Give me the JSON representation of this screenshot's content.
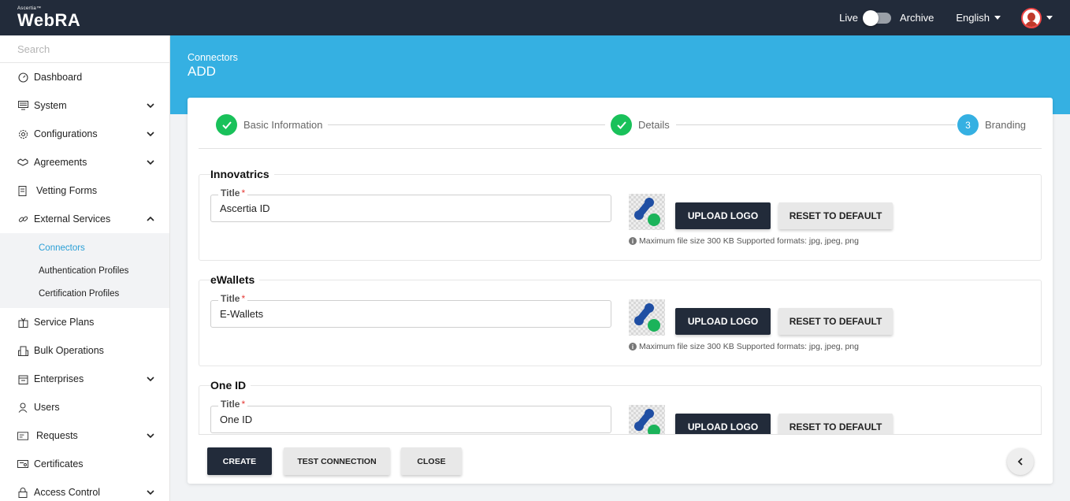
{
  "header": {
    "brand_small": "Ascertia™",
    "brand_main": "WebRA",
    "live_label": "Live",
    "archive_label": "Archive",
    "language": "English"
  },
  "search": {
    "placeholder": "Search"
  },
  "sidebar": {
    "items": [
      {
        "label": "Dashboard",
        "icon": "dashboard-icon",
        "expandable": false
      },
      {
        "label": "System",
        "icon": "system-icon",
        "expandable": true
      },
      {
        "label": "Configurations",
        "icon": "gear-icon",
        "expandable": true
      },
      {
        "label": "Agreements",
        "icon": "handshake-icon",
        "expandable": true
      },
      {
        "label": "Vetting Forms",
        "icon": "form-icon",
        "expandable": false
      },
      {
        "label": "External Services",
        "icon": "link-icon",
        "expandable": true,
        "expanded": true
      },
      {
        "label": "Service Plans",
        "icon": "gift-icon",
        "expandable": false
      },
      {
        "label": "Bulk Operations",
        "icon": "building-icon",
        "expandable": false
      },
      {
        "label": "Enterprises",
        "icon": "enterprise-icon",
        "expandable": true
      },
      {
        "label": "Users",
        "icon": "user-icon",
        "expandable": false
      },
      {
        "label": "Requests",
        "icon": "requests-icon",
        "expandable": true
      },
      {
        "label": "Certificates",
        "icon": "certificate-icon",
        "expandable": false
      },
      {
        "label": "Access Control",
        "icon": "lock-icon",
        "expandable": true
      }
    ],
    "sub_items": [
      {
        "label": "Connectors",
        "active": true
      },
      {
        "label": "Authentication Profiles",
        "active": false
      },
      {
        "label": "Certification Profiles",
        "active": false
      }
    ]
  },
  "page": {
    "breadcrumb": "Connectors",
    "title": "ADD"
  },
  "stepper": {
    "steps": [
      {
        "label": "Basic Information",
        "state": "done"
      },
      {
        "label": "Details",
        "state": "done"
      },
      {
        "number": "3",
        "label": "Branding",
        "state": "current"
      }
    ]
  },
  "sections": [
    {
      "title": "Innovatrics",
      "field_label": "Title",
      "field_value": "Ascertia ID"
    },
    {
      "title": "eWallets",
      "field_label": "Title",
      "field_value": "E-Wallets"
    },
    {
      "title": "One ID",
      "field_label": "Title",
      "field_value": "One ID"
    }
  ],
  "section_actions": {
    "upload_label": "UPLOAD LOGO",
    "reset_label": "RESET TO DEFAULT",
    "hint": "Maximum file size 300 KB Supported formats: jpg, jpeg, png"
  },
  "footer": {
    "create_label": "CREATE",
    "test_label": "TEST CONNECTION",
    "close_label": "CLOSE"
  },
  "colors": {
    "topbar": "#222b3a",
    "accent": "#35b0e2",
    "success": "#19c15a",
    "active_link": "#2a9fd6"
  }
}
